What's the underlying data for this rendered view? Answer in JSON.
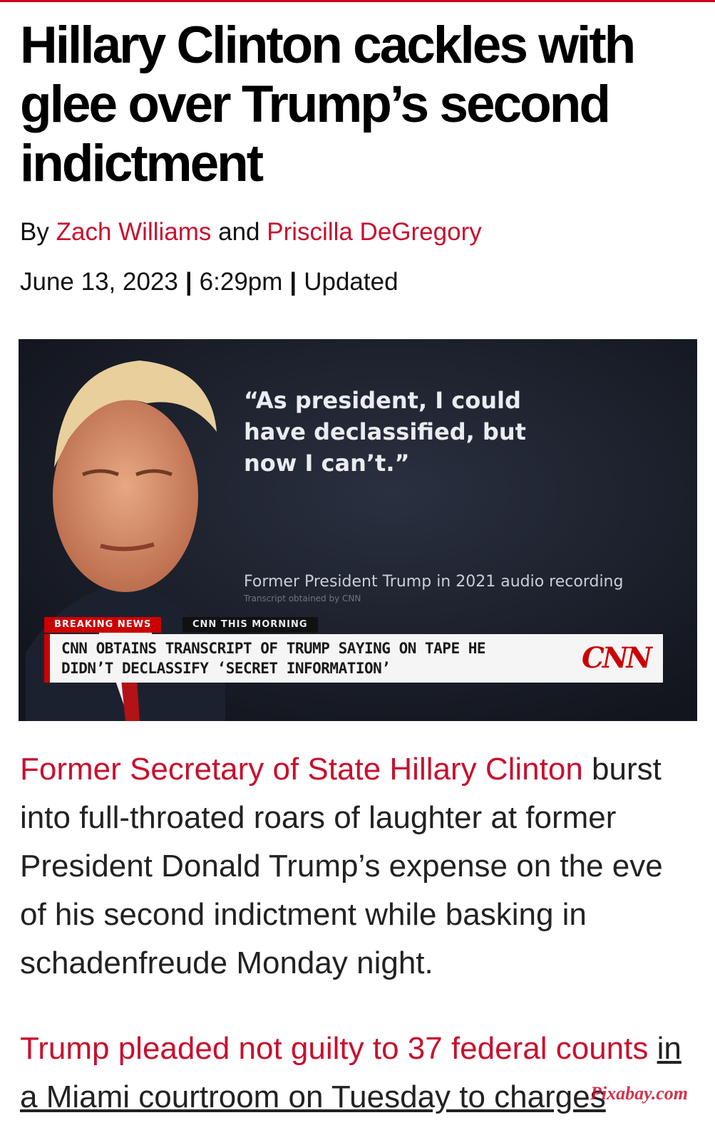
{
  "article": {
    "headline": "Hillary Clinton cackles with glee over Trump’s second indictment",
    "byline": {
      "prefix": "By",
      "author_1": "Zach Williams",
      "conjunction": "and",
      "author_2": "Priscilla DeGregory"
    },
    "date": "June 13, 2023",
    "separator": "|",
    "time": "6:29pm",
    "updated_label": "Updated"
  },
  "media": {
    "quote": "“As president, I could have declassified, but now I can’t.”",
    "attribution": "Former President Trump in 2021 audio recording",
    "attribution_sub": "Transcript obtained by CNN",
    "breaking_label": "BREAKING NEWS",
    "show_label": "CNN THIS MORNING",
    "chyron": "CNN OBTAINS TRANSCRIPT OF TRUMP SAYING ON TAPE HE DIDN’T DECLASSIFY ‘SECRET INFORMATION’",
    "network_logo": "CNN"
  },
  "body": {
    "p1_link": "Former Secretary of State Hillary Clinton",
    "p1_text": "burst into full-throated roars of laughter at former President Donald Trump’s expense on the eve of his second indictment while basking in schadenfreude Monday night.",
    "p2_link": "Trump pleaded not guilty to 37 federal counts",
    "p2_text": "in a Miami courtroom on Tuesday to charges"
  },
  "watermark": "Pixabay.com",
  "colors": {
    "accent_red": "#c8102e",
    "cnn_red": "#cc0000",
    "broadcast_bg": "#1a1f2b"
  }
}
